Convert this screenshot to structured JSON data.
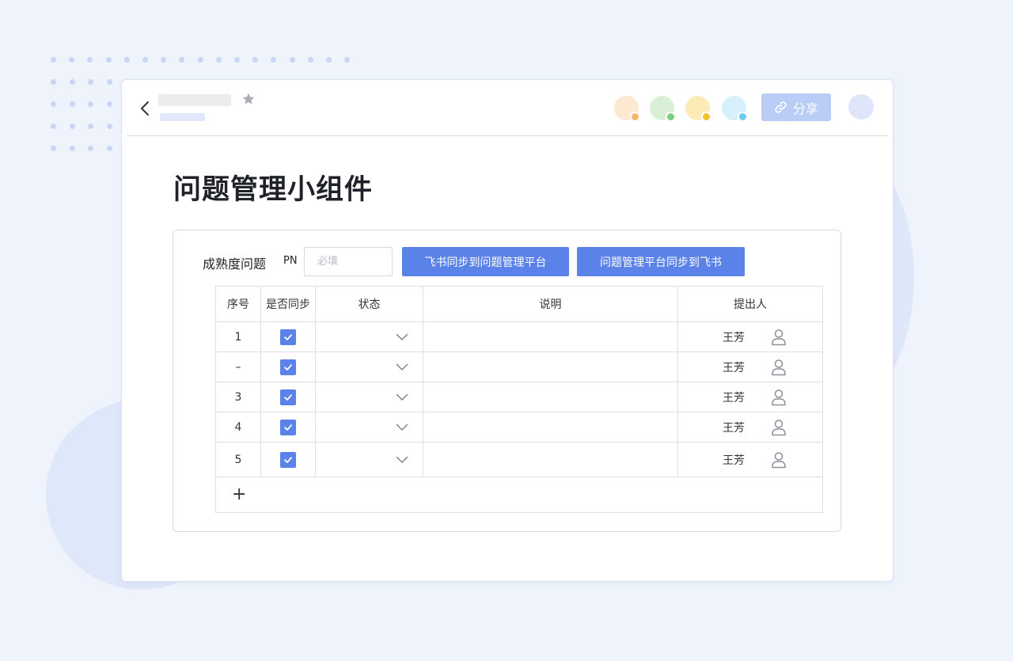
{
  "header": {
    "share_label": "分享",
    "collaborators": [
      {
        "bg": "#fde8d2",
        "status": "#f6b56b"
      },
      {
        "bg": "#d9f0d6",
        "status": "#7ccf7a"
      },
      {
        "bg": "#fbecb7",
        "status": "#f0c42e"
      },
      {
        "bg": "#d7f1fa",
        "status": "#6fc9ea"
      }
    ]
  },
  "page": {
    "title": "问题管理小组件"
  },
  "widget": {
    "label": "成熟度问题",
    "pn_label": "PN",
    "pn_placeholder": "必填",
    "btn_sync_to_platform": "飞书同步到问题管理平台",
    "btn_sync_to_feishu": "问题管理平台同步到飞书",
    "columns": [
      "序号",
      "是否同步",
      "状态",
      "说明",
      "提出人"
    ],
    "rows": [
      {
        "index": "1",
        "synced": true,
        "status": "",
        "desc": "",
        "submitter": "王芳"
      },
      {
        "index": "–",
        "synced": true,
        "status": "",
        "desc": "",
        "submitter": "王芳"
      },
      {
        "index": "3",
        "synced": true,
        "status": "",
        "desc": "",
        "submitter": "王芳"
      },
      {
        "index": "4",
        "synced": true,
        "status": "",
        "desc": "",
        "submitter": "王芳"
      },
      {
        "index": "5",
        "synced": true,
        "status": "",
        "desc": "",
        "submitter": "王芳"
      }
    ],
    "add_label": "+"
  },
  "colors": {
    "accent": "#5a82e8",
    "share_bg": "#b9cdf6",
    "page_bg": "#eff4fc"
  }
}
